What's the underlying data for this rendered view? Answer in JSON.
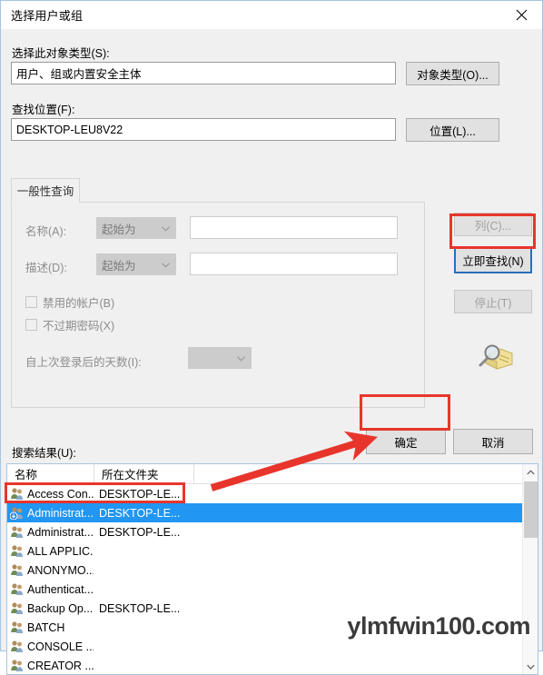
{
  "window": {
    "title": "选择用户或组",
    "close_icon": "close-icon"
  },
  "object_type": {
    "label": "选择此对象类型(S):",
    "value": "用户、组或内置安全主体",
    "button": "对象类型(O)..."
  },
  "location": {
    "label": "查找位置(F):",
    "value": "DESKTOP-LEU8V22",
    "button": "位置(L)..."
  },
  "tabs": [
    {
      "label": "一般性查询",
      "active": true
    }
  ],
  "query": {
    "name_label": "名称(A):",
    "name_condition": "起始为",
    "name_value": "",
    "desc_label": "描述(D):",
    "desc_condition": "起始为",
    "desc_value": "",
    "disabled_accounts_label": "禁用的帐户(B)",
    "disabled_accounts_checked": false,
    "nonexpiring_password_label": "不过期密码(X)",
    "nonexpiring_password_checked": false,
    "days_since_logon_label": "自上次登录后的天数(I):",
    "days_since_logon_value": ""
  },
  "side_buttons": {
    "columns": "列(C)...",
    "find_now": "立即查找(N)",
    "stop": "停止(T)",
    "search_icon": "magnifier-folder-icon"
  },
  "dialog_buttons": {
    "ok": "确定",
    "cancel": "取消"
  },
  "results": {
    "label": "搜索结果(U):",
    "columns": [
      "名称",
      "所在文件夹",
      ""
    ],
    "rows": [
      {
        "name": "Access Con...",
        "folder": "DESKTOP-LE...",
        "selected": false
      },
      {
        "name": "Administrat...",
        "folder": "DESKTOP-LE...",
        "selected": true
      },
      {
        "name": "Administrat...",
        "folder": "DESKTOP-LE...",
        "selected": false
      },
      {
        "name": "ALL APPLIC...",
        "folder": "",
        "selected": false
      },
      {
        "name": "ANONYMO...",
        "folder": "",
        "selected": false
      },
      {
        "name": "Authenticat...",
        "folder": "",
        "selected": false
      },
      {
        "name": "Backup Op...",
        "folder": "DESKTOP-LE...",
        "selected": false
      },
      {
        "name": "BATCH",
        "folder": "",
        "selected": false
      },
      {
        "name": "CONSOLE ...",
        "folder": "",
        "selected": false
      },
      {
        "name": "CREATOR ...",
        "folder": "",
        "selected": false
      }
    ]
  },
  "annotations": {
    "highlight_color": "#e8352c",
    "selection_color": "#2196f3",
    "watermark": "ylmfwin100.com"
  }
}
